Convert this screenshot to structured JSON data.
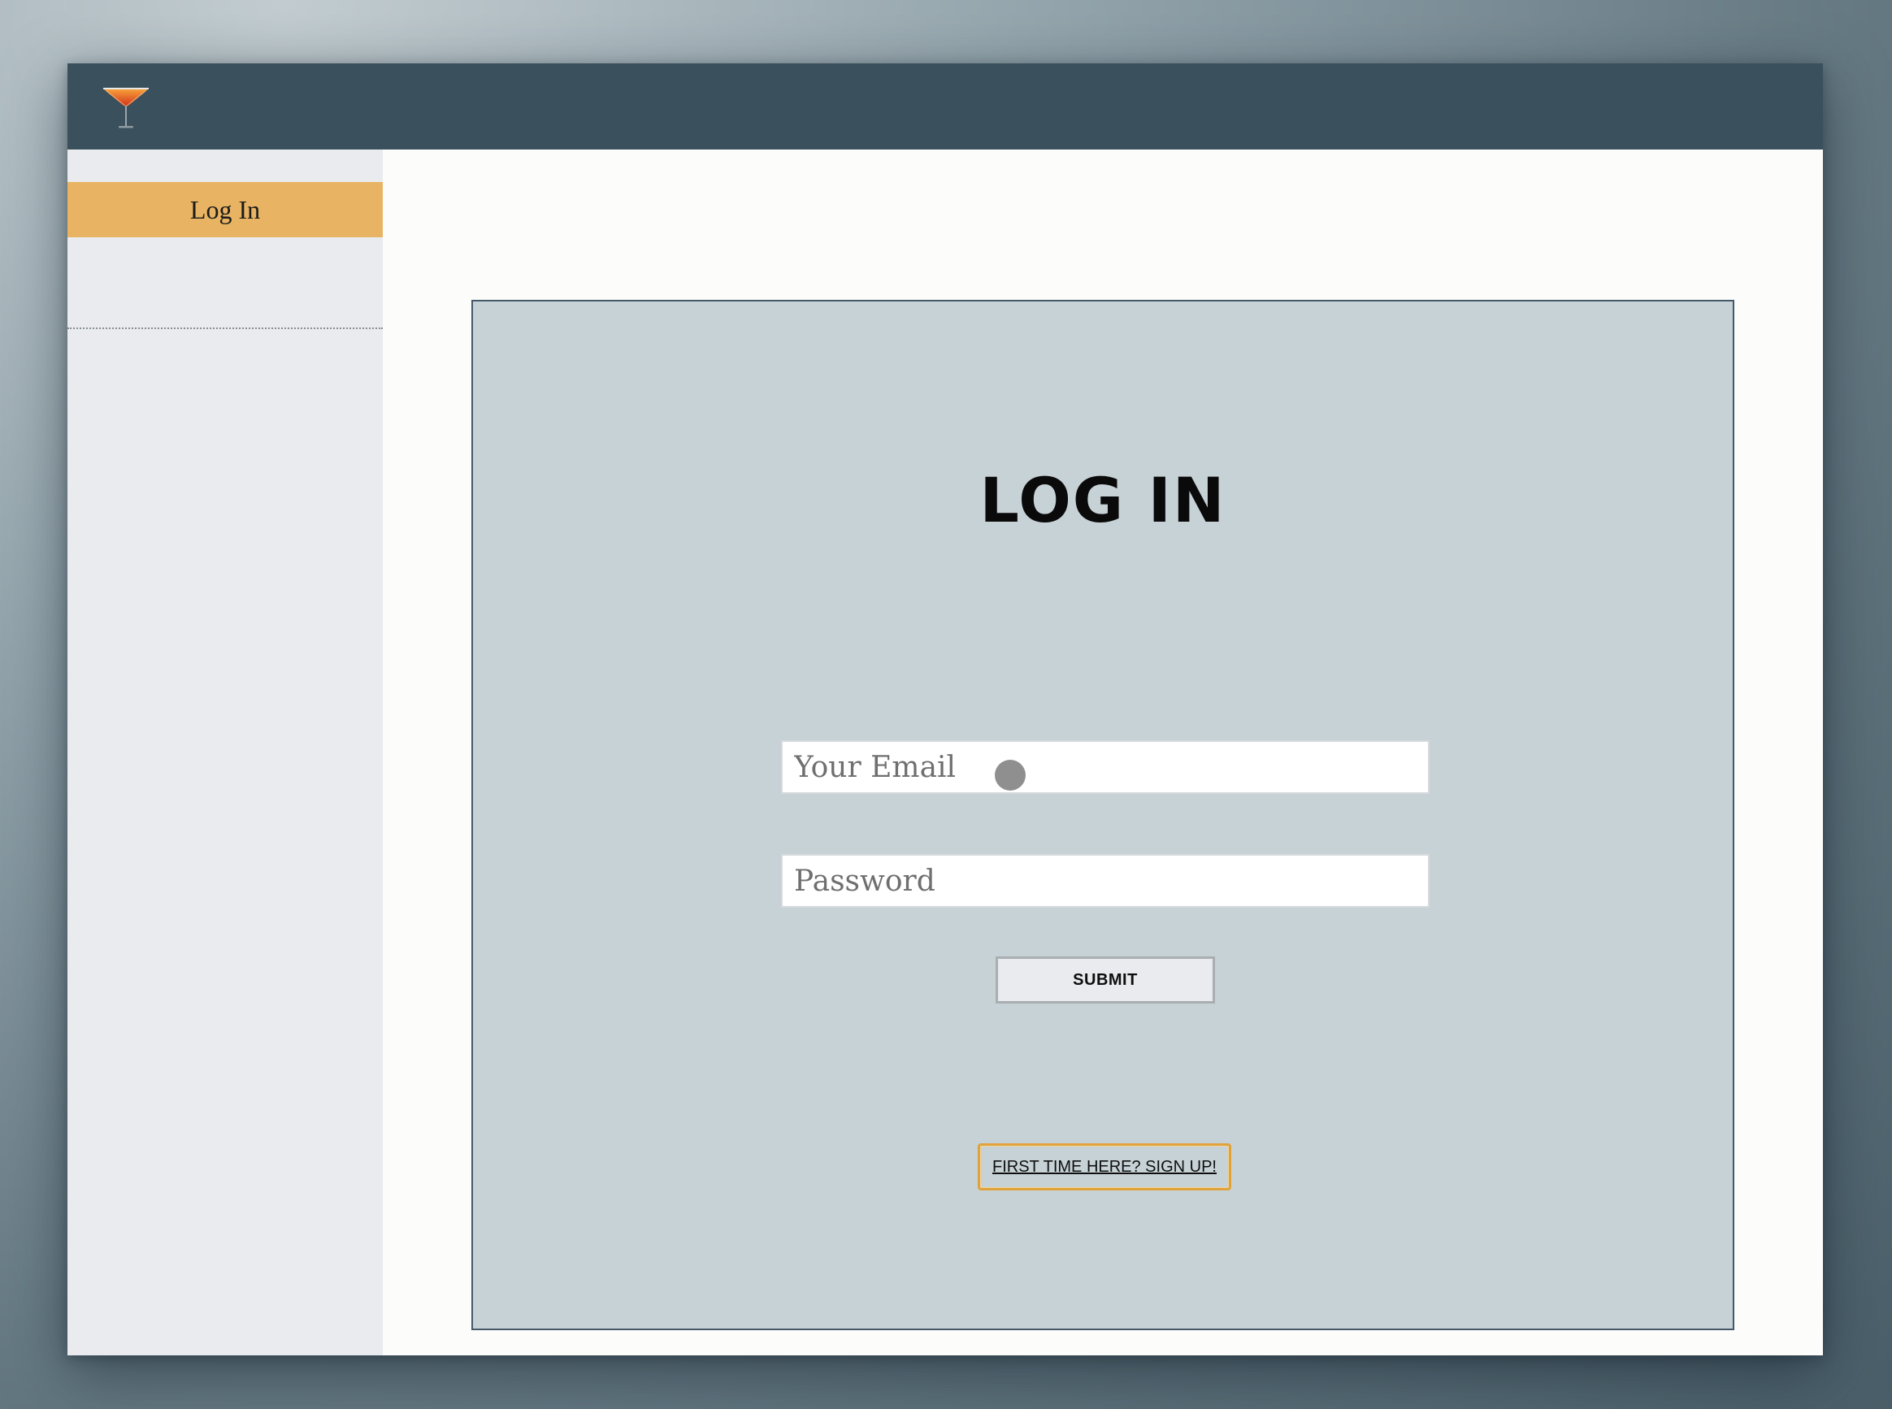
{
  "header": {
    "logo_icon": "cocktail-glass-icon"
  },
  "sidebar": {
    "items": [
      {
        "label": "Log In",
        "active": true
      }
    ]
  },
  "main": {
    "title": "LOG IN",
    "form": {
      "email_placeholder": "Your Email",
      "email_value": "",
      "password_placeholder": "Password",
      "password_value": "",
      "submit_label": "SUBMIT"
    },
    "signup_label": "FIRST TIME HERE? SIGN UP!"
  },
  "colors": {
    "header": "#3a505c",
    "sidebar_bg": "#e9ebee",
    "nav_active": "#e8b463",
    "panel_bg": "#c7d2d6",
    "panel_border": "#44586a",
    "focus_outline": "#e0a33c"
  }
}
